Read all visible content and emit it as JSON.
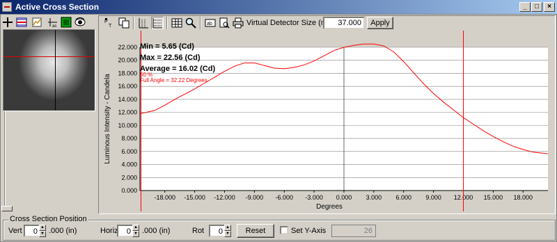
{
  "window": {
    "title": "Active Cross Section"
  },
  "toolbar": {
    "virtual_detector_label": "Virtual Detector Size (mm)",
    "virtual_detector_value": "37.000",
    "apply_label": "Apply",
    "icons": [
      "crosshair-icon",
      "cross-section-icon",
      "chart-icon",
      "axis-icon",
      "fill-icon",
      "eye-icon",
      "text-point-icon",
      "copy-icon",
      "grid-lines-icon",
      "grid-lines-dense-icon",
      "table-icon",
      "zoom-icon",
      "label-icon",
      "print-preview-icon",
      "print-icon"
    ]
  },
  "stats": {
    "min": "Min = 5.65 (Cd)",
    "max": "Max = 22.56 (Cd)",
    "average": "Average = 16.02 (Cd)",
    "percent": "50 %",
    "full_angle": "Full Angle = 32.22 Degrees"
  },
  "chart_data": {
    "type": "line",
    "xlabel": "Degrees",
    "ylabel": "Luminous Intensity - Candela",
    "xlim": [
      -20.5,
      20.5
    ],
    "ylim": [
      0,
      22
    ],
    "x_ticks": [
      "-18.000",
      "-15.000",
      "-12.000",
      "-9.000",
      "-6.000",
      "-3.000",
      "0.000",
      "3.000",
      "6.000",
      "9.000",
      "12.000",
      "15.000",
      "18.000"
    ],
    "y_ticks": [
      "0.000",
      "2.000",
      "4.000",
      "6.000",
      "8.000",
      "10.000",
      "12.000",
      "14.000",
      "16.000",
      "18.000",
      "20.000",
      "22.000"
    ],
    "x_tick_values": [
      -18,
      -15,
      -12,
      -9,
      -6,
      -3,
      0,
      3,
      6,
      9,
      12,
      15,
      18
    ],
    "y_tick_values": [
      0,
      2,
      4,
      6,
      8,
      10,
      12,
      14,
      16,
      18,
      20,
      22
    ],
    "series": [
      {
        "color": "#ff0000",
        "x": [
          -20.5,
          -19,
          -18,
          -17,
          -16,
          -15,
          -14,
          -13,
          -12,
          -11,
          -10,
          -9,
          -8,
          -7,
          -6,
          -5,
          -4,
          -3,
          -2,
          -1,
          0,
          1,
          2,
          3,
          4,
          5,
          6,
          7,
          8,
          9,
          10,
          11,
          12,
          13,
          14,
          15,
          16,
          17,
          18,
          19,
          20.5
        ],
        "y": [
          11.8,
          12.3,
          13.1,
          14.0,
          14.8,
          15.6,
          16.5,
          17.4,
          18.3,
          19.1,
          19.6,
          19.6,
          19.2,
          18.8,
          18.7,
          18.9,
          19.3,
          19.9,
          20.7,
          21.5,
          22.0,
          22.3,
          22.5,
          22.5,
          22.2,
          21.3,
          19.8,
          18.1,
          16.4,
          14.9,
          13.6,
          12.4,
          11.2,
          10.2,
          9.2,
          8.3,
          7.5,
          6.8,
          6.3,
          5.9,
          5.65
        ]
      }
    ],
    "markers": [
      {
        "x": -20.4,
        "color": "#ff0000"
      },
      {
        "x": 12.0,
        "color": "#ff0000"
      }
    ],
    "center_line_x": 0
  },
  "bottom": {
    "group_label": "Cross Section Position",
    "vert_label": "Vert",
    "vert_value": "0",
    "vert_unit": ".000 (in)",
    "horiz_label": "Horiz",
    "horiz_value": "0",
    "horiz_unit": ".000 (in)",
    "rot_label": "Rot",
    "rot_value": "0",
    "reset_label": "Reset",
    "set_y_axis_label": "Set Y-Axis",
    "y_axis_value": "26"
  }
}
